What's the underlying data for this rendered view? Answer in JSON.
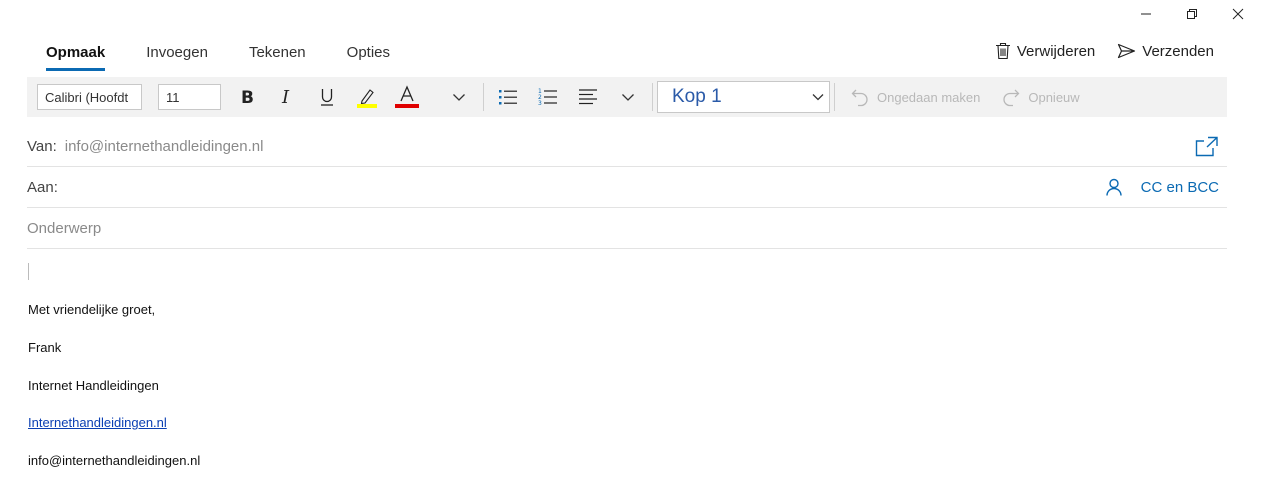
{
  "tabs": [
    "Opmaak",
    "Invoegen",
    "Tekenen",
    "Opties"
  ],
  "actions": {
    "delete_label": "Verwijderen",
    "send_label": "Verzenden"
  },
  "toolbar": {
    "font_name": "Calibri (Hoofdt",
    "font_size": "11",
    "style_value": "Kop 1",
    "undo_label": "Ongedaan maken",
    "redo_label": "Opnieuw",
    "highlight_color": "#ffff00",
    "font_color": "#e00000"
  },
  "fields": {
    "from_label": "Van:",
    "from_value": "info@internethandleidingen.nl",
    "to_label": "Aan:",
    "cc_bcc_label": "CC en BCC",
    "subject_placeholder": "Onderwerp"
  },
  "signature": {
    "greeting": "Met vriendelijke groet,",
    "name": "Frank",
    "company": "Internet Handleidingen",
    "website": "Internethandleidingen.nl",
    "email": "info@internethandleidingen.nl"
  },
  "colors": {
    "accent": "#0b6ab3"
  }
}
